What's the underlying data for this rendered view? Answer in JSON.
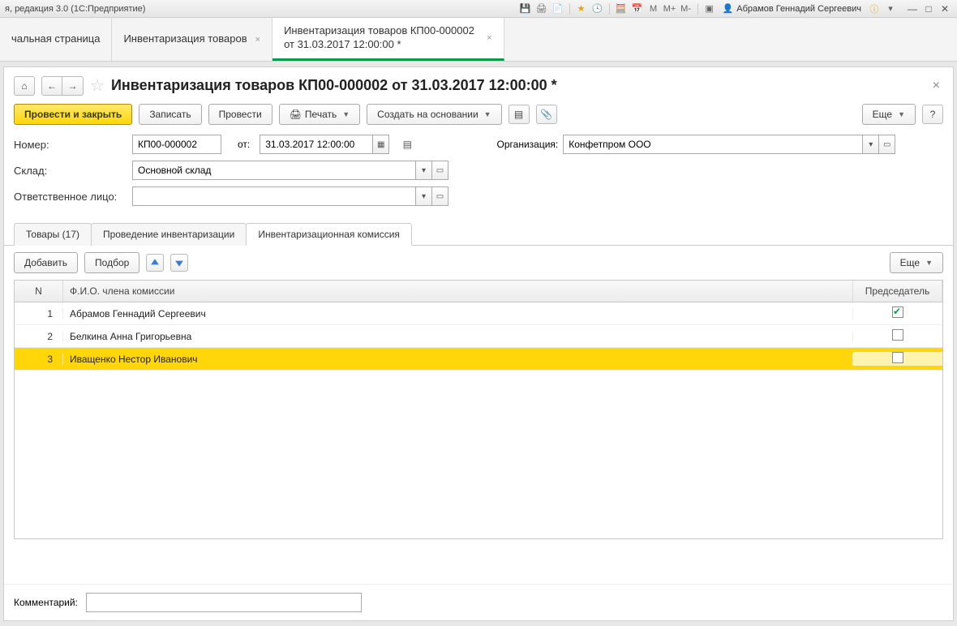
{
  "titlebar": {
    "left_text": "я, редакция 3.0  (1С:Предприятие)",
    "calc_m": "M",
    "calc_mp": "M+",
    "calc_mm": "M-",
    "user_name": "Абрамов Геннадий Сергеевич"
  },
  "app_tabs": {
    "t0": "чальная страница",
    "t1": "Инвентаризация товаров",
    "t2": "Инвентаризация товаров КП00-000002 от 31.03.2017 12:00:00 *"
  },
  "doc": {
    "title": "Инвентаризация товаров КП00-000002 от 31.03.2017 12:00:00 *"
  },
  "toolbar": {
    "process_close": "Провести и закрыть",
    "save": "Записать",
    "process": "Провести",
    "print": "Печать",
    "create_based": "Создать на основании",
    "more": "Еще",
    "help": "?"
  },
  "form": {
    "number_label": "Номер:",
    "number_value": "КП00-000002",
    "from_label": "от:",
    "date_value": "31.03.2017 12:00:00",
    "org_label": "Организация:",
    "org_value": "Конфетпром ООО",
    "warehouse_label": "Склад:",
    "warehouse_value": "Основной склад",
    "responsible_label": "Ответственное лицо:",
    "responsible_value": ""
  },
  "sub_tabs": {
    "t0": "Товары (17)",
    "t1": "Проведение инвентаризации",
    "t2": "Инвентаризационная комиссия"
  },
  "grid_toolbar": {
    "add": "Добавить",
    "pick": "Подбор",
    "more": "Еще"
  },
  "grid": {
    "col_n": "N",
    "col_name": "Ф.И.О. члена комиссии",
    "col_chair": "Председатель",
    "rows": [
      {
        "n": "1",
        "name": "Абрамов Геннадий Сергеевич",
        "chair": true
      },
      {
        "n": "2",
        "name": "Белкина Анна Григорьевна",
        "chair": false
      },
      {
        "n": "3",
        "name": "Иващенко Нестор Иванович",
        "chair": false
      }
    ]
  },
  "comment": {
    "label": "Комментарий:",
    "value": ""
  }
}
